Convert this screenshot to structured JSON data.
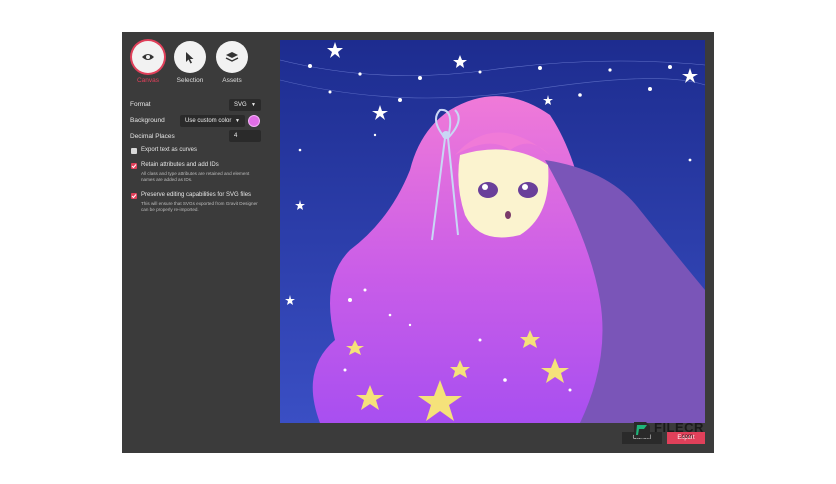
{
  "modes": [
    {
      "label": "Canvas",
      "icon": "eye-icon",
      "active": true
    },
    {
      "label": "Selection",
      "icon": "cursor-icon",
      "active": false
    },
    {
      "label": "Assets",
      "icon": "layers-icon",
      "active": false
    }
  ],
  "settings": {
    "format_label": "Format",
    "format_value": "SVG",
    "background_label": "Background",
    "background_value": "Use custom color",
    "background_color": "#e06ee6",
    "decimal_label": "Decimal Places",
    "decimal_value": "4"
  },
  "options": [
    {
      "label": "Export text as curves",
      "checked": false,
      "description": ""
    },
    {
      "label": "Retain attributes and add IDs",
      "checked": true,
      "description": "All class and type attributes are retained and element names are added as IDs."
    },
    {
      "label": "Preserve editing capabilities for SVG files",
      "checked": true,
      "description": "This will ensure that SVGs exported from Gravit Designer can be properly re-imported."
    }
  ],
  "footer": {
    "cancel_label": "Cancel",
    "export_label": "Export"
  },
  "watermark": {
    "brand": "FILECR",
    "domain": ".com"
  },
  "colors": {
    "accent": "#e0405a",
    "panel": "#3b3b3b",
    "sky": "#2a3aa8",
    "hair": "#e06ee6"
  }
}
